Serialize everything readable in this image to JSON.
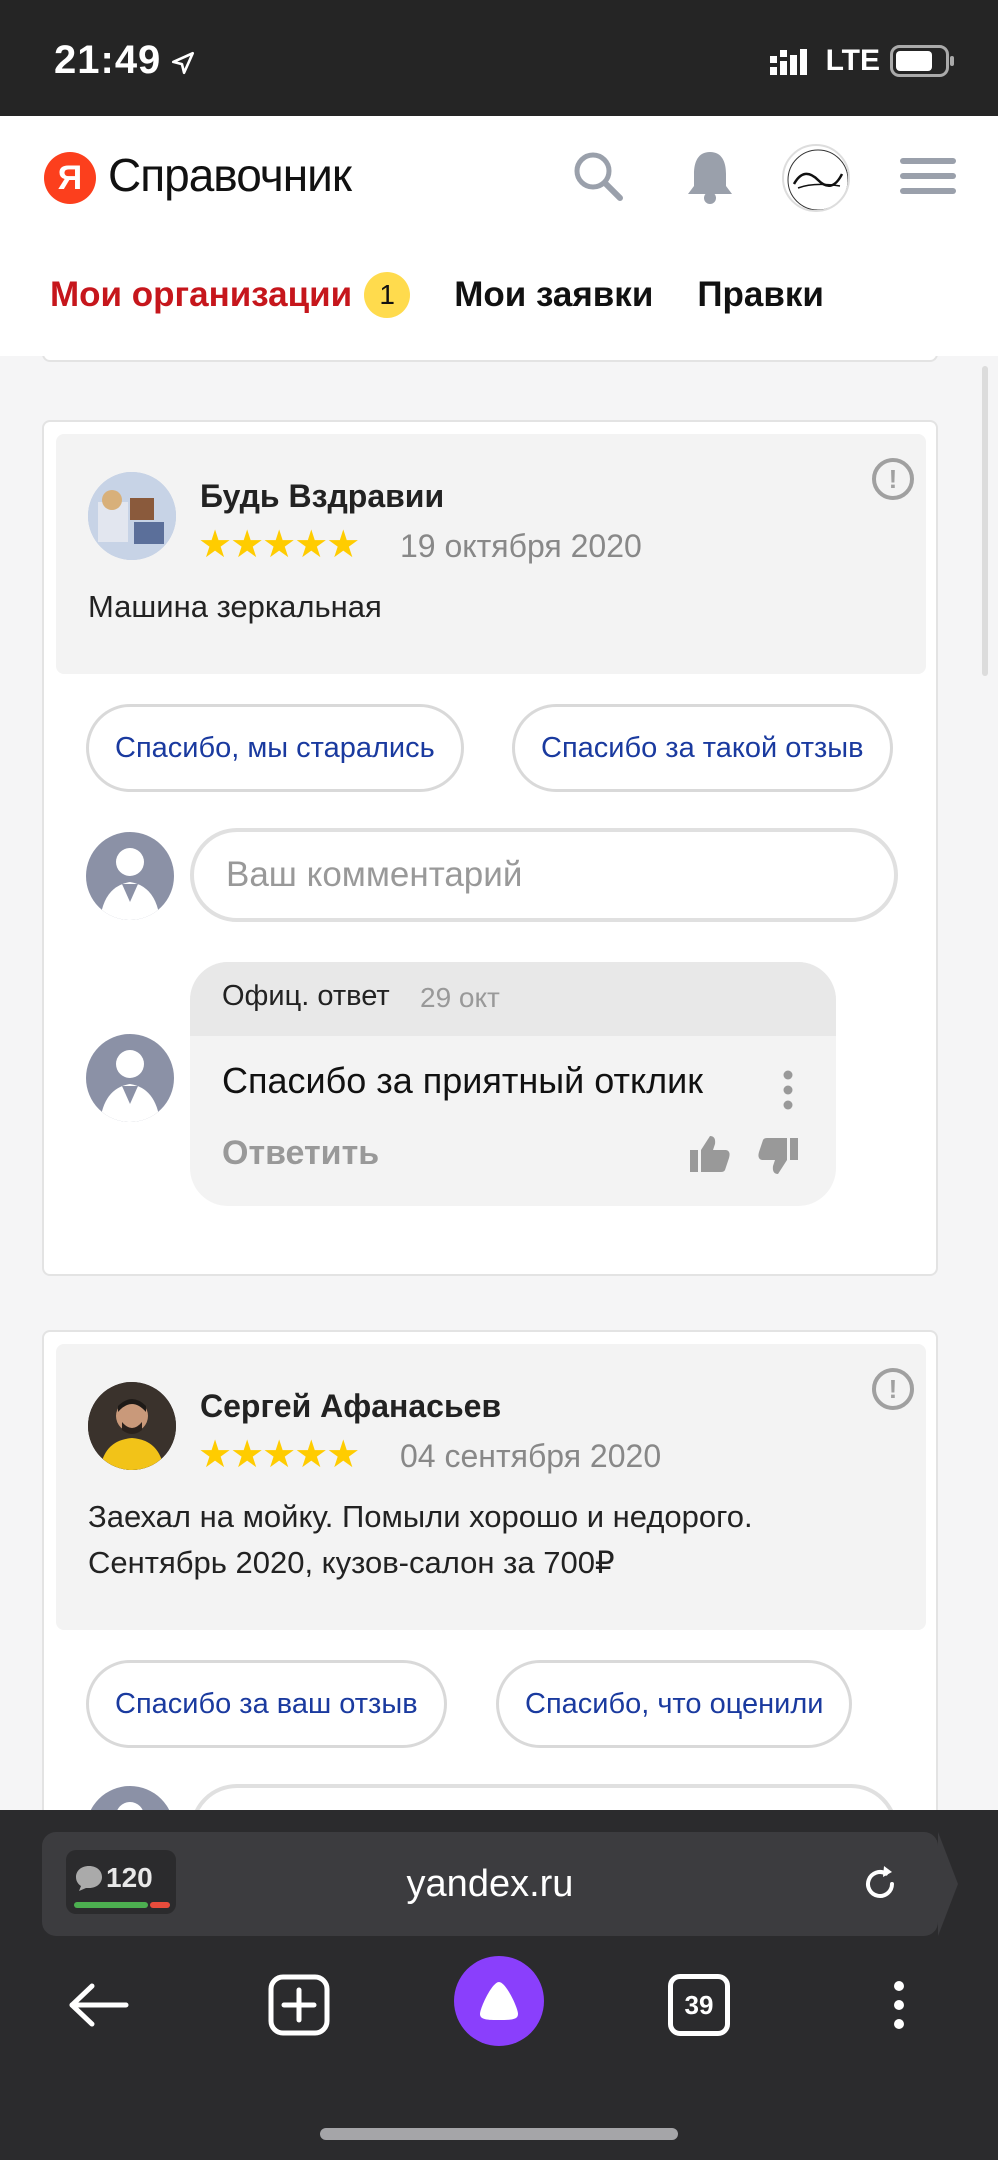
{
  "status_bar": {
    "time": "21:49",
    "network": "LTE"
  },
  "header": {
    "logo_letter": "Я",
    "logo_text": "Справочник",
    "tabs": [
      {
        "label": "Мои организации",
        "badge": "1",
        "active": true
      },
      {
        "label": "Мои заявки"
      },
      {
        "label": "Правки"
      }
    ]
  },
  "reviews": [
    {
      "author": "Будь Вздравии",
      "rating": 5,
      "stars": "★★★★★",
      "date": "19 октября 2020",
      "text": "Машина зеркальная",
      "quick_replies": [
        "Спасибо, мы старались",
        "Спасибо за такой отзыв"
      ],
      "comment_placeholder": "Ваш комментарий",
      "official_reply": {
        "label": "Офиц. ответ",
        "date": "29 окт",
        "text": "Спасибо за приятный отклик",
        "reply_action": "Ответить"
      }
    },
    {
      "author": "Сергей Афанасьев",
      "rating": 5,
      "stars": "★★★★★",
      "date": "04 сентября 2020",
      "text_line1": "Заехал на мойку. Помыли хорошо и недорого.",
      "text_line2": "Сентябрь 2020, кузов-салон за 700₽",
      "quick_replies": [
        "Спасибо за ваш отзыв",
        "Спасибо, что оценили"
      ]
    }
  ],
  "browser": {
    "url": "yandex.ru",
    "comments_count": "120",
    "tabs_count": "39"
  },
  "colors": {
    "accent_red": "#c6161c",
    "link_blue": "#1a3a9f",
    "star_yellow": "#ffcc00",
    "badge_yellow": "#ffdb4d",
    "alice_purple": "#8a3ffc"
  }
}
